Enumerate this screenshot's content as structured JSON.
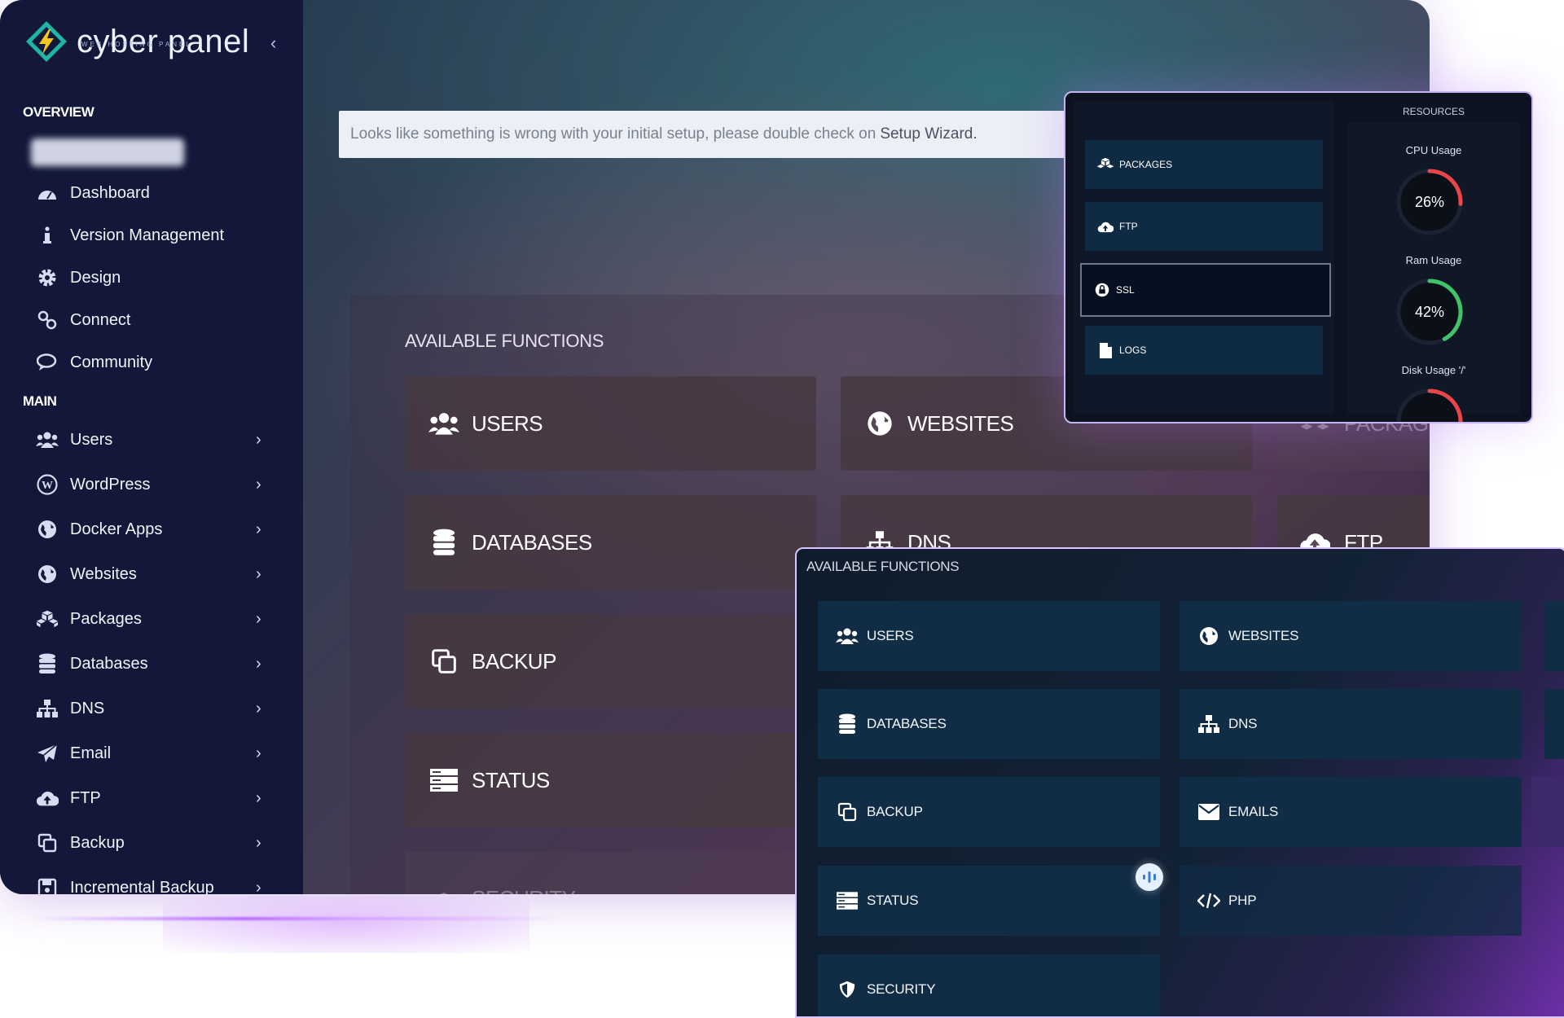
{
  "brand": {
    "name": "cyber panel",
    "subtitle": "WEB HOSTING PANEL"
  },
  "sidebar": {
    "overview_title": "OVERVIEW",
    "main_title": "MAIN",
    "overview_items": [
      {
        "label": "Dashboard",
        "icon": "dashboard-icon"
      },
      {
        "label": "Version Management",
        "icon": "info-icon"
      },
      {
        "label": "Design",
        "icon": "gear-icon"
      },
      {
        "label": "Connect",
        "icon": "link-icon"
      },
      {
        "label": "Community",
        "icon": "chat-icon"
      }
    ],
    "main_items": [
      {
        "label": "Users",
        "icon": "users-icon"
      },
      {
        "label": "WordPress",
        "icon": "wordpress-icon"
      },
      {
        "label": "Docker Apps",
        "icon": "globe-icon"
      },
      {
        "label": "Websites",
        "icon": "globe-icon"
      },
      {
        "label": "Packages",
        "icon": "cubes-icon"
      },
      {
        "label": "Databases",
        "icon": "database-icon"
      },
      {
        "label": "DNS",
        "icon": "sitemap-icon"
      },
      {
        "label": "Email",
        "icon": "send-icon"
      },
      {
        "label": "FTP",
        "icon": "cloud-upload-icon"
      },
      {
        "label": "Backup",
        "icon": "copy-icon"
      },
      {
        "label": "Incremental Backup",
        "icon": "save-icon"
      }
    ]
  },
  "alert": {
    "text": "Looks like something is wrong with your initial setup, please double check on",
    "link": "Setup Wizard."
  },
  "main": {
    "functions_title": "AVAILABLE FUNCTIONS",
    "functions": [
      {
        "label": "USERS",
        "icon": "users-icon"
      },
      {
        "label": "WEBSITES",
        "icon": "globe-icon"
      },
      {
        "label": "PACKAGES",
        "icon": "cubes-icon"
      },
      {
        "label": "DATABASES",
        "icon": "database-icon"
      },
      {
        "label": "DNS",
        "icon": "sitemap-icon"
      },
      {
        "label": "FTP",
        "icon": "cloud-upload-icon"
      },
      {
        "label": "BACKUP",
        "icon": "copy-icon"
      },
      {
        "label": "STATUS",
        "icon": "server-icon"
      },
      {
        "label": "SECURITY",
        "icon": "shield-icon"
      }
    ]
  },
  "resources_card": {
    "buttons": [
      {
        "label": "PACKAGES",
        "icon": "cubes-icon"
      },
      {
        "label": "FTP",
        "icon": "cloud-upload-icon"
      },
      {
        "label": "SSL",
        "icon": "lock-icon"
      },
      {
        "label": "LOGS",
        "icon": "file-icon"
      }
    ],
    "header": "RESOURCES",
    "gauges": [
      {
        "label": "CPU Usage",
        "value_text": "26%",
        "value": 26,
        "color": "#e8464a"
      },
      {
        "label": "Ram Usage",
        "value_text": "42%",
        "value": 42,
        "color": "#3fc46a"
      },
      {
        "label": "Disk Usage '/'",
        "value_text": "",
        "value": 60,
        "color": "#e8464a"
      }
    ]
  },
  "functions_card": {
    "title": "AVAILABLE FUNCTIONS",
    "items": [
      {
        "label": "USERS",
        "icon": "users-icon"
      },
      {
        "label": "WEBSITES",
        "icon": "globe-icon"
      },
      {
        "label": "DATABASES",
        "icon": "database-icon"
      },
      {
        "label": "DNS",
        "icon": "sitemap-icon"
      },
      {
        "label": "BACKUP",
        "icon": "copy-icon"
      },
      {
        "label": "EMAILS",
        "icon": "envelope-icon"
      },
      {
        "label": "STATUS",
        "icon": "server-icon"
      },
      {
        "label": "PHP",
        "icon": "code-icon"
      },
      {
        "label": "SECURITY",
        "icon": "shield-icon"
      }
    ]
  },
  "colors": {
    "sidebar": "#13183a",
    "tile": "#112c45",
    "accent_glow": "#b66bff"
  }
}
